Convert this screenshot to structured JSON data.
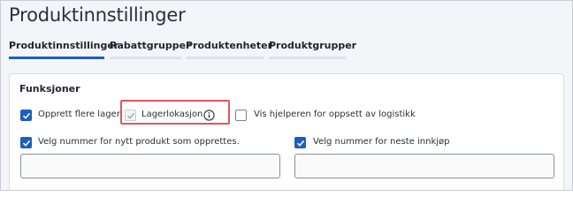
{
  "header": {
    "title": "Produktinnstillinger"
  },
  "tabs": [
    {
      "label": "Produktinnstillinger",
      "active": true
    },
    {
      "label": "Rabattgrupper",
      "active": false
    },
    {
      "label": "Produktenheter",
      "active": false
    },
    {
      "label": "Produktgrupper",
      "active": false
    }
  ],
  "section": {
    "title": "Funksjoner",
    "options": [
      {
        "label": "Opprett flere lager",
        "checked": true,
        "disabled": false
      },
      {
        "label": "Lagerlokasjon",
        "checked": true,
        "disabled": true,
        "info_icon": "info-circle-icon",
        "highlighted": true
      },
      {
        "label": "Vis hjelperen for oppsett av logistikk",
        "checked": false,
        "disabled": false
      },
      {
        "label": "Velg nummer for nytt produkt som opprettes.",
        "checked": true,
        "disabled": false
      },
      {
        "label": "Velg nummer for neste innkjøp",
        "checked": true,
        "disabled": false
      }
    ],
    "inputs": [
      {
        "value": "",
        "placeholder": ""
      },
      {
        "value": "",
        "placeholder": ""
      }
    ]
  },
  "colors": {
    "accent": "#1d5fbf",
    "highlight_border": "#e0565e",
    "page_background": "#f4f5f8"
  }
}
